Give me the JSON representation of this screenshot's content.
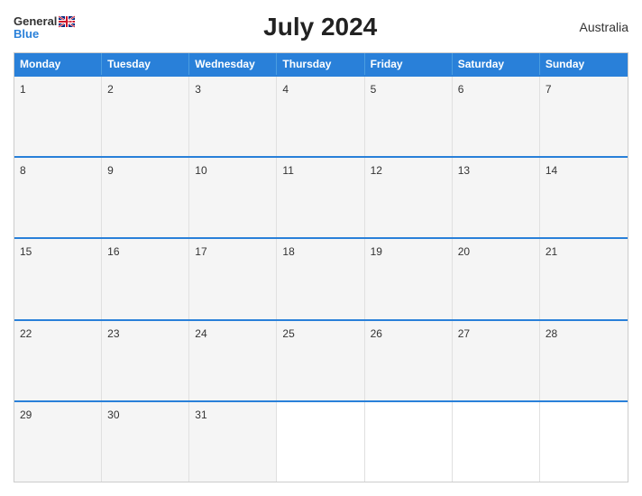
{
  "header": {
    "logo_general": "General",
    "logo_blue": "Blue",
    "title": "July 2024",
    "country": "Australia"
  },
  "day_headers": [
    "Monday",
    "Tuesday",
    "Wednesday",
    "Thursday",
    "Friday",
    "Saturday",
    "Sunday"
  ],
  "weeks": [
    [
      {
        "day": "1",
        "empty": false
      },
      {
        "day": "2",
        "empty": false
      },
      {
        "day": "3",
        "empty": false
      },
      {
        "day": "4",
        "empty": false
      },
      {
        "day": "5",
        "empty": false
      },
      {
        "day": "6",
        "empty": false
      },
      {
        "day": "7",
        "empty": false
      }
    ],
    [
      {
        "day": "8",
        "empty": false
      },
      {
        "day": "9",
        "empty": false
      },
      {
        "day": "10",
        "empty": false
      },
      {
        "day": "11",
        "empty": false
      },
      {
        "day": "12",
        "empty": false
      },
      {
        "day": "13",
        "empty": false
      },
      {
        "day": "14",
        "empty": false
      }
    ],
    [
      {
        "day": "15",
        "empty": false
      },
      {
        "day": "16",
        "empty": false
      },
      {
        "day": "17",
        "empty": false
      },
      {
        "day": "18",
        "empty": false
      },
      {
        "day": "19",
        "empty": false
      },
      {
        "day": "20",
        "empty": false
      },
      {
        "day": "21",
        "empty": false
      }
    ],
    [
      {
        "day": "22",
        "empty": false
      },
      {
        "day": "23",
        "empty": false
      },
      {
        "day": "24",
        "empty": false
      },
      {
        "day": "25",
        "empty": false
      },
      {
        "day": "26",
        "empty": false
      },
      {
        "day": "27",
        "empty": false
      },
      {
        "day": "28",
        "empty": false
      }
    ],
    [
      {
        "day": "29",
        "empty": false
      },
      {
        "day": "30",
        "empty": false
      },
      {
        "day": "31",
        "empty": false
      },
      {
        "day": "",
        "empty": true
      },
      {
        "day": "",
        "empty": true
      },
      {
        "day": "",
        "empty": true
      },
      {
        "day": "",
        "empty": true
      }
    ]
  ]
}
